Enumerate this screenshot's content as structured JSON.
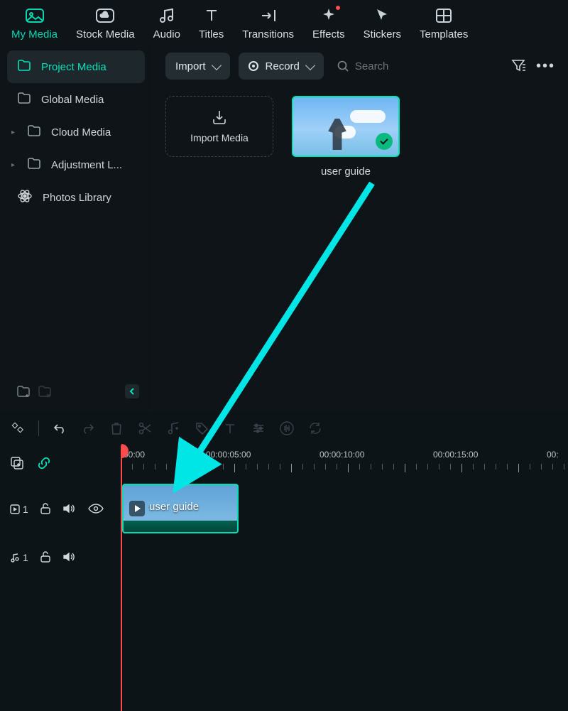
{
  "topbar": [
    {
      "label": "My Media",
      "icon": "image"
    },
    {
      "label": "Stock Media",
      "icon": "cloud"
    },
    {
      "label": "Audio",
      "icon": "music"
    },
    {
      "label": "Titles",
      "icon": "text"
    },
    {
      "label": "Transitions",
      "icon": "transition"
    },
    {
      "label": "Effects",
      "icon": "sparkle"
    },
    {
      "label": "Stickers",
      "icon": "cursor"
    },
    {
      "label": "Templates",
      "icon": "grid"
    }
  ],
  "sidebar": {
    "items": [
      {
        "label": "Project Media",
        "icon": "folder",
        "indent": false
      },
      {
        "label": "Global Media",
        "icon": "folder",
        "indent": false
      },
      {
        "label": "Cloud Media",
        "icon": "folder",
        "indent": true
      },
      {
        "label": "Adjustment L...",
        "icon": "folder",
        "indent": true
      },
      {
        "label": "Photos Library",
        "icon": "atom",
        "indent": false
      }
    ]
  },
  "content_top": {
    "import": "Import",
    "record": "Record",
    "search_placeholder": "Search"
  },
  "import_card": "Import Media",
  "clip": {
    "label": "user guide"
  },
  "ruler": {
    "labels": [
      "00:00",
      "00:00:05:00",
      "00:00:10:00",
      "00:00:15:00",
      "00:"
    ]
  },
  "tracks": {
    "video": {
      "num": "1"
    },
    "audio": {
      "num": "1"
    }
  },
  "timeline_clip": {
    "name": "user guide"
  }
}
